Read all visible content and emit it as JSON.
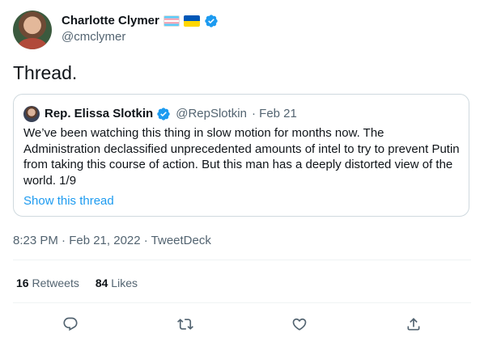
{
  "author": {
    "name": "Charlotte Clymer",
    "handle": "@cmclymer",
    "flags": [
      "transgender-flag",
      "ukraine-flag"
    ],
    "verified": true
  },
  "tweet": {
    "text": "Thread.",
    "timestamp": "8:23 PM · Feb 21, 2022 · TweetDeck"
  },
  "quote": {
    "name": "Rep. Elissa Slotkin",
    "handle": "@RepSlotkin",
    "date": "· Feb 21",
    "body": "We’ve been watching this thing in slow motion for months now. The Administration declassified unprecedented amounts of intel to try to prevent Putin from taking this course of action. But this man has a deeply distorted view of the world. 1/9",
    "link_label": "Show this thread"
  },
  "stats": {
    "retweets_count": "16",
    "retweets_label": "Retweets",
    "likes_count": "84",
    "likes_label": "Likes"
  },
  "actions": [
    "reply-icon",
    "retweet-icon",
    "like-icon",
    "share-icon"
  ],
  "colors": {
    "accent": "#1d9bf0",
    "secondary_text": "#536471",
    "primary_text": "#0f1419",
    "border": "#cfd9de"
  }
}
